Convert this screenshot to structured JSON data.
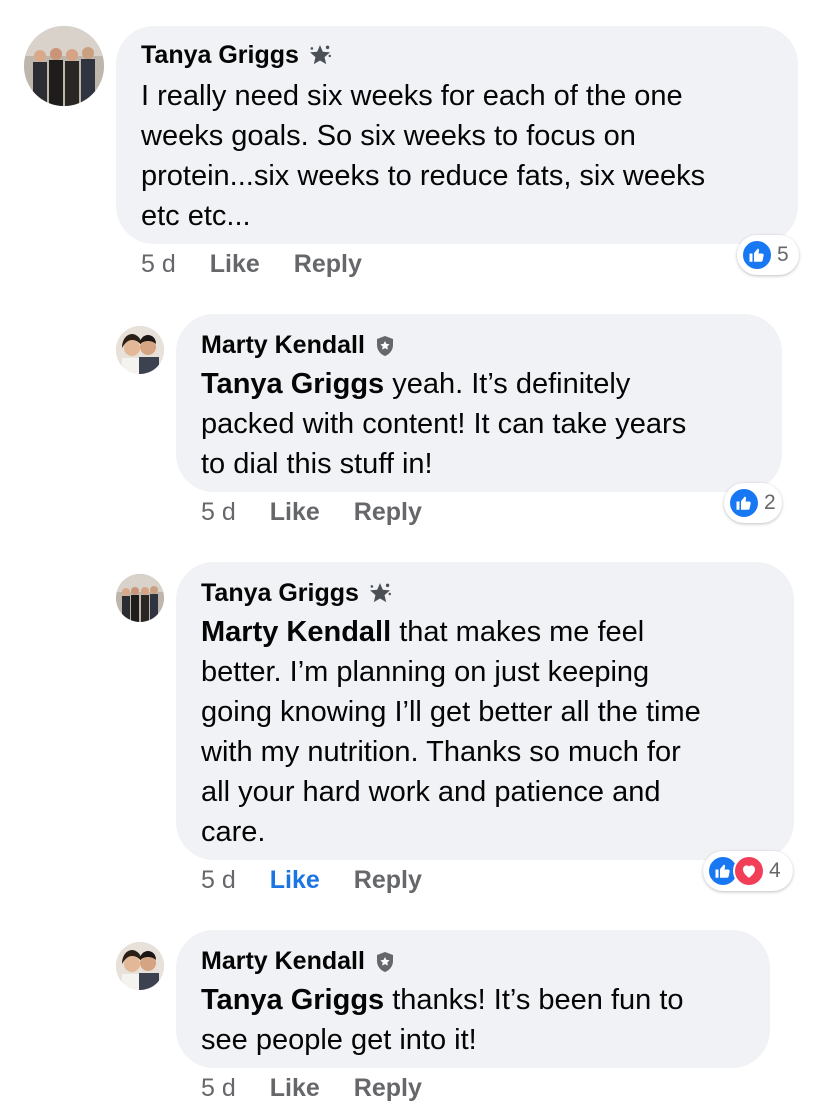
{
  "comments": [
    {
      "author": "Tanya Griggs",
      "text_lines": [
        "I really need six weeks for each of the one",
        "weeks goals. So six weeks to focus on",
        "protein...six weeks to reduce fats, six weeks",
        "etc etc..."
      ],
      "time": "5 d",
      "like_label": "Like",
      "reply_label": "Reply",
      "reaction_count": "5"
    },
    {
      "author": "Marty Kendall",
      "mention": "Tanya Griggs",
      "text_lines": [
        " yeah.  It’s definitely",
        "packed with content!  It can take years",
        "to dial this stuff in!"
      ],
      "time": "5 d",
      "like_label": "Like",
      "reply_label": "Reply",
      "reaction_count": "2"
    },
    {
      "author": "Tanya Griggs",
      "mention": "Marty Kendall",
      "text_lines": [
        " that makes me feel",
        "better. I’m planning on just keeping",
        "going knowing I’ll get better all the time",
        "with my nutrition. Thanks so much for",
        "all your hard work and patience and",
        "care."
      ],
      "time": "5 d",
      "like_label": "Like",
      "reply_label": "Reply",
      "reaction_count": "4"
    },
    {
      "author": "Marty Kendall",
      "mention": "Tanya Griggs",
      "text_lines": [
        " thanks!  It’s been fun to",
        "see people get into it!"
      ],
      "time": "5 d",
      "like_label": "Like",
      "reply_label": "Reply"
    }
  ],
  "colors": {
    "bubble": "#f0f2f5",
    "secondary_text": "#65676b",
    "like_active": "#1b74e4",
    "like_reaction": "#1877f2",
    "love_reaction": "#f33e58"
  },
  "icons": {
    "fan_badge": "star-badge-icon",
    "moderator_badge": "shield-badge-icon",
    "like_reaction": "thumbs-up-icon",
    "love_reaction": "heart-icon"
  }
}
